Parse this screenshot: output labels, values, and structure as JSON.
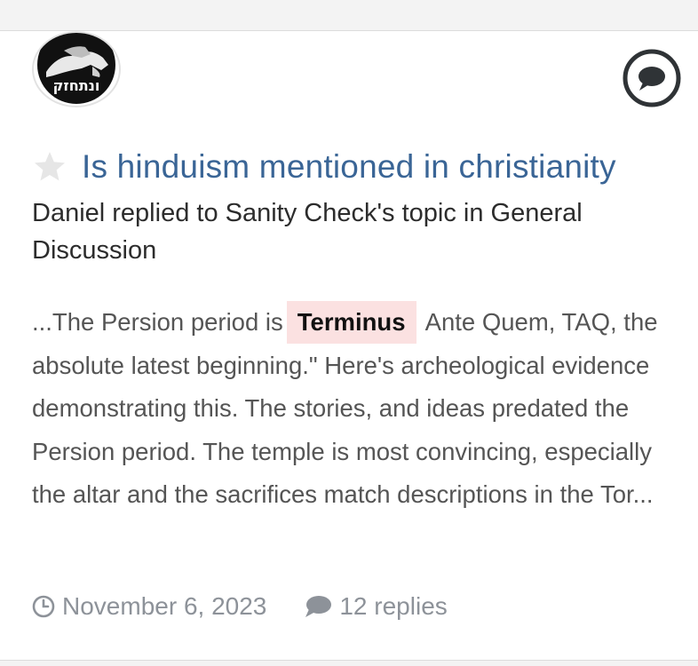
{
  "post": {
    "avatar_text": "ונתחזק",
    "title": "Is hinduism mentioned in christianity",
    "byline": "Daniel replied to Sanity Check's topic in General Discussion",
    "snippet_before": "...The Persion period is",
    "snippet_highlight": "Terminus",
    "snippet_after": "Ante Quem, TAQ, the absolute latest beginning.\" Here's archeological evidence demonstrating this. The stories, and ideas predated the Persion period. The temple is most convincing, especially the altar and the sacrifices match descriptions in the Tor...",
    "date": "November 6, 2023",
    "replies": "12 replies"
  },
  "icons": {
    "avatar": "avatar-image",
    "star": "star-icon",
    "comment": "comment-bubble-icon",
    "clock": "clock-icon",
    "replies": "speech-bubble-icon"
  },
  "colors": {
    "title": "#3a6596",
    "highlight_bg": "#fbe1e1",
    "meta": "#8d9299",
    "star": "#e6e6e6"
  }
}
